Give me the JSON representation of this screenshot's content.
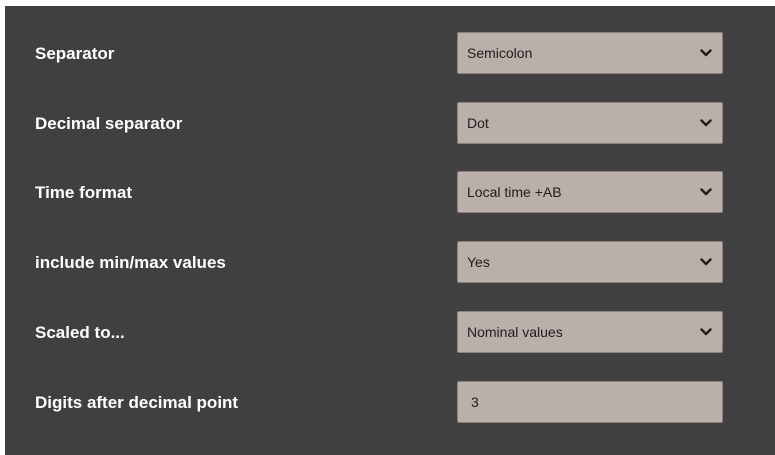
{
  "settings": [
    {
      "label": "Separator",
      "value": "Semicolon",
      "kind": "select",
      "icon": "chevron-down-icon"
    },
    {
      "label": "Decimal separator",
      "value": "Dot",
      "kind": "select",
      "icon": "chevron-down-icon"
    },
    {
      "label": "Time format",
      "value": "Local time +AB",
      "kind": "select",
      "icon": "chevron-down-icon"
    },
    {
      "label": "include min/max values",
      "value": "Yes",
      "kind": "select",
      "icon": "chevron-down-icon"
    },
    {
      "label": "Scaled to...",
      "value": "Nominal values",
      "kind": "select",
      "icon": "chevron-down-icon"
    },
    {
      "label": "Digits after decimal point",
      "value": "3",
      "kind": "text"
    }
  ],
  "colors": {
    "panel_background": "#404040",
    "control_background": "#bbafaa",
    "label_text": "#ffffff",
    "value_text": "#1e1e1e"
  }
}
